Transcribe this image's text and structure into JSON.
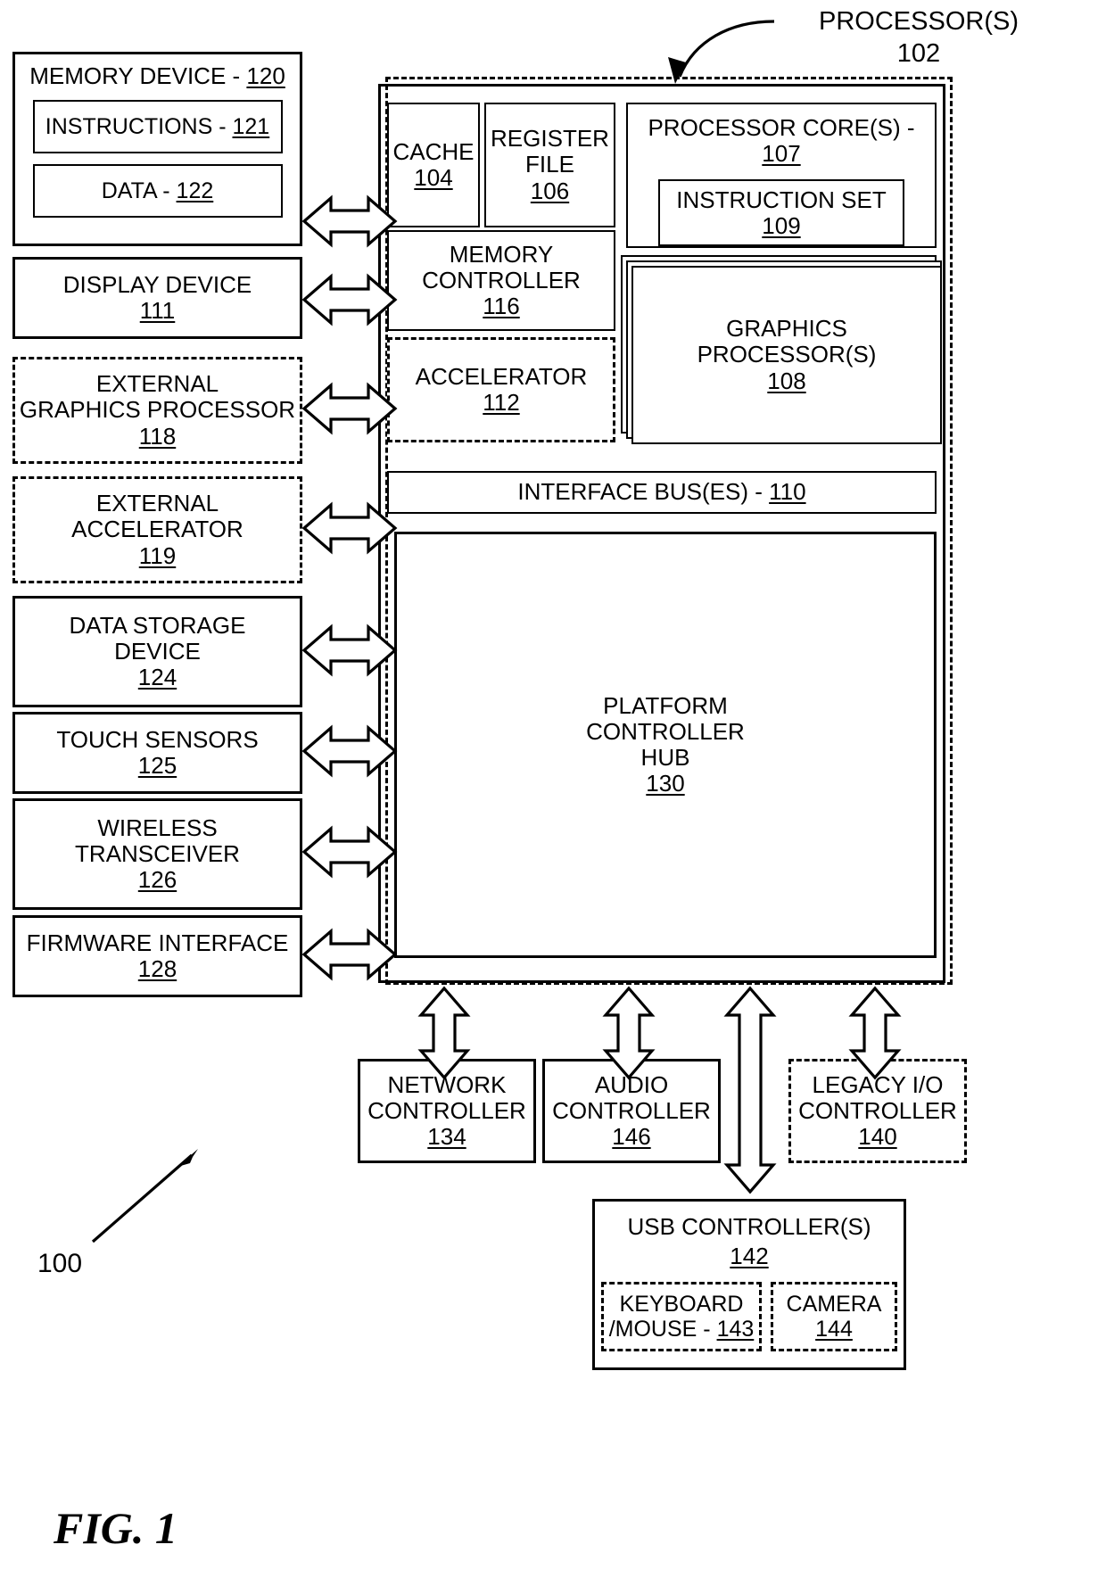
{
  "figure": {
    "caption": "FIG. 1",
    "system_ref": "100"
  },
  "callouts": {
    "processors": {
      "label": "PROCESSOR(S)",
      "num": "102"
    }
  },
  "left_column": [
    {
      "name": "memory-device",
      "label": "MEMORY DEVICE",
      "sep": " - ",
      "num": "120",
      "title_top": true,
      "children": [
        {
          "name": "instructions",
          "label": "INSTRUCTIONS",
          "sep": " - ",
          "num": "121"
        },
        {
          "name": "data",
          "label": "DATA",
          "sep": " - ",
          "num": "122"
        }
      ]
    },
    {
      "name": "display-device",
      "lines": [
        "DISPLAY DEVICE"
      ],
      "num": "111",
      "dashed": false
    },
    {
      "name": "external-graphics-processor",
      "lines": [
        "EXTERNAL",
        "GRAPHICS PROCESSOR"
      ],
      "num": "118",
      "dashed": true
    },
    {
      "name": "external-accelerator",
      "lines": [
        "EXTERNAL",
        "ACCELERATOR"
      ],
      "num": "119",
      "dashed": true
    },
    {
      "name": "data-storage-device",
      "lines": [
        "DATA STORAGE",
        "DEVICE"
      ],
      "num": "124",
      "dashed": false
    },
    {
      "name": "touch-sensors",
      "lines": [
        "TOUCH SENSORS"
      ],
      "num": "125",
      "dashed": false
    },
    {
      "name": "wireless-transceiver",
      "lines": [
        "WIRELESS",
        "TRANSCEIVER"
      ],
      "num": "126",
      "dashed": false
    },
    {
      "name": "firmware-interface",
      "lines": [
        "FIRMWARE INTERFACE"
      ],
      "num": "128",
      "dashed": false
    }
  ],
  "processor_block": {
    "cache": {
      "lines": [
        "CACHE"
      ],
      "num": "104"
    },
    "register_file": {
      "lines": [
        "REGISTER",
        "FILE"
      ],
      "num": "106"
    },
    "memory_controller": {
      "lines": [
        "MEMORY",
        "CONTROLLER"
      ],
      "num": "116"
    },
    "accelerator": {
      "lines": [
        "ACCELERATOR"
      ],
      "num": "112",
      "dashed": true
    },
    "processor_cores": {
      "label": "PROCESSOR CORE(S)",
      "sep": " - ",
      "num": "107"
    },
    "instruction_set": {
      "lines": [
        "INSTRUCTION SET"
      ],
      "num": "109"
    },
    "graphics_processors": {
      "lines": [
        "GRAPHICS",
        "PROCESSOR(S)"
      ],
      "num": "108"
    },
    "interface_bus": {
      "label": "INTERFACE BUS(ES)",
      "sep": " - ",
      "num": "110"
    },
    "platform_controller_hub": {
      "lines": [
        "PLATFORM",
        "CONTROLLER",
        "HUB"
      ],
      "num": "130"
    }
  },
  "bottom_row": [
    {
      "name": "network-controller",
      "lines": [
        "NETWORK",
        "CONTROLLER"
      ],
      "num": "134",
      "dashed": false
    },
    {
      "name": "audio-controller",
      "lines": [
        "AUDIO",
        "CONTROLLER"
      ],
      "num": "146",
      "dashed": false
    },
    {
      "name": "legacy-io-controller",
      "lines": [
        "LEGACY I/O",
        "CONTROLLER"
      ],
      "num": "140",
      "dashed": true
    }
  ],
  "usb": {
    "controller": {
      "label": "USB CONTROLLER(S)",
      "num": "142"
    },
    "keyboard_mouse": {
      "line1": "KEYBOARD",
      "line2": "/MOUSE",
      "sep": " - ",
      "num": "143"
    },
    "camera": {
      "lines": [
        "CAMERA"
      ],
      "num": "144"
    }
  },
  "colors": {
    "stroke": "#000000",
    "background": "#ffffff"
  }
}
